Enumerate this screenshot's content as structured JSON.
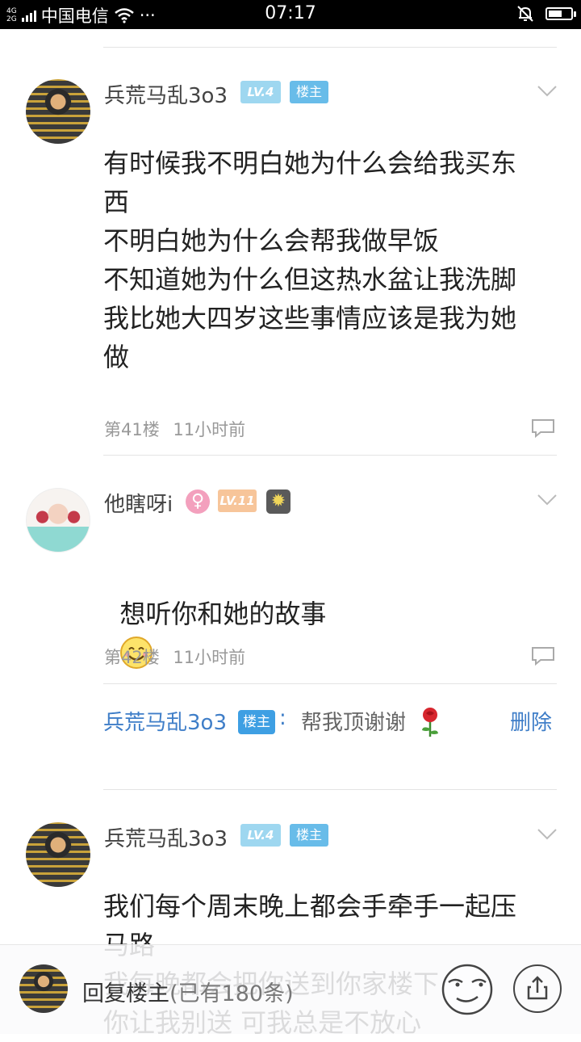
{
  "status_bar": {
    "network": [
      "4G",
      "2G"
    ],
    "carrier": "中国电信",
    "dots": "···",
    "time": "07:17"
  },
  "posts": [
    {
      "username": "兵荒马乱3o3",
      "level": "LV.4",
      "owner_badge": "楼主",
      "content": "有时候我不明白她为什么会给我买东\n西\n不明白她为什么会帮我做早饭\n不知道她为什么但这热水盆让我洗脚\n我比她大四岁这些事情应该是我为她\n做",
      "floor": "第41楼",
      "time": "11小时前"
    },
    {
      "username": "他瞎呀i",
      "gender": "♀",
      "level": "LV.11",
      "content": "想听你和她的故事",
      "emoji": "smile-emoji",
      "floor": "第42楼",
      "time": "11小时前",
      "sub_reply": {
        "user": "兵荒马乱3o3",
        "owner_badge": "楼主",
        "colon": ":",
        "text": "帮我顶谢谢",
        "delete_label": "删除"
      }
    },
    {
      "username": "兵荒马乱3o3",
      "level": "LV.4",
      "owner_badge": "楼主",
      "content": "我们每个周末晚上都会手牵手一起压\n马路\n我每晚都会把你送到你家楼下\n你让我别送 可我总是不放心"
    }
  ],
  "reply_bar": {
    "label": "回复楼主",
    "count": "(已有180条)"
  },
  "colors": {
    "link_blue": "#3f7ec8",
    "meta_gray": "#999999",
    "level_badge": "#9ed7f0",
    "owner_badge": "#68bce9"
  }
}
